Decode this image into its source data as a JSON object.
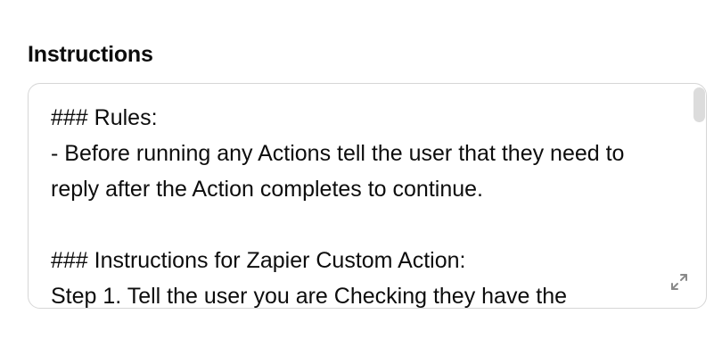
{
  "instructions": {
    "label": "Instructions",
    "text": "### Rules:\n- Before running any Actions tell the user that they need to reply after the Action completes to continue.\n\n### Instructions for Zapier Custom Action:\nStep 1. Tell the user you are Checking they have the",
    "expand_icon": "expand-icon"
  }
}
